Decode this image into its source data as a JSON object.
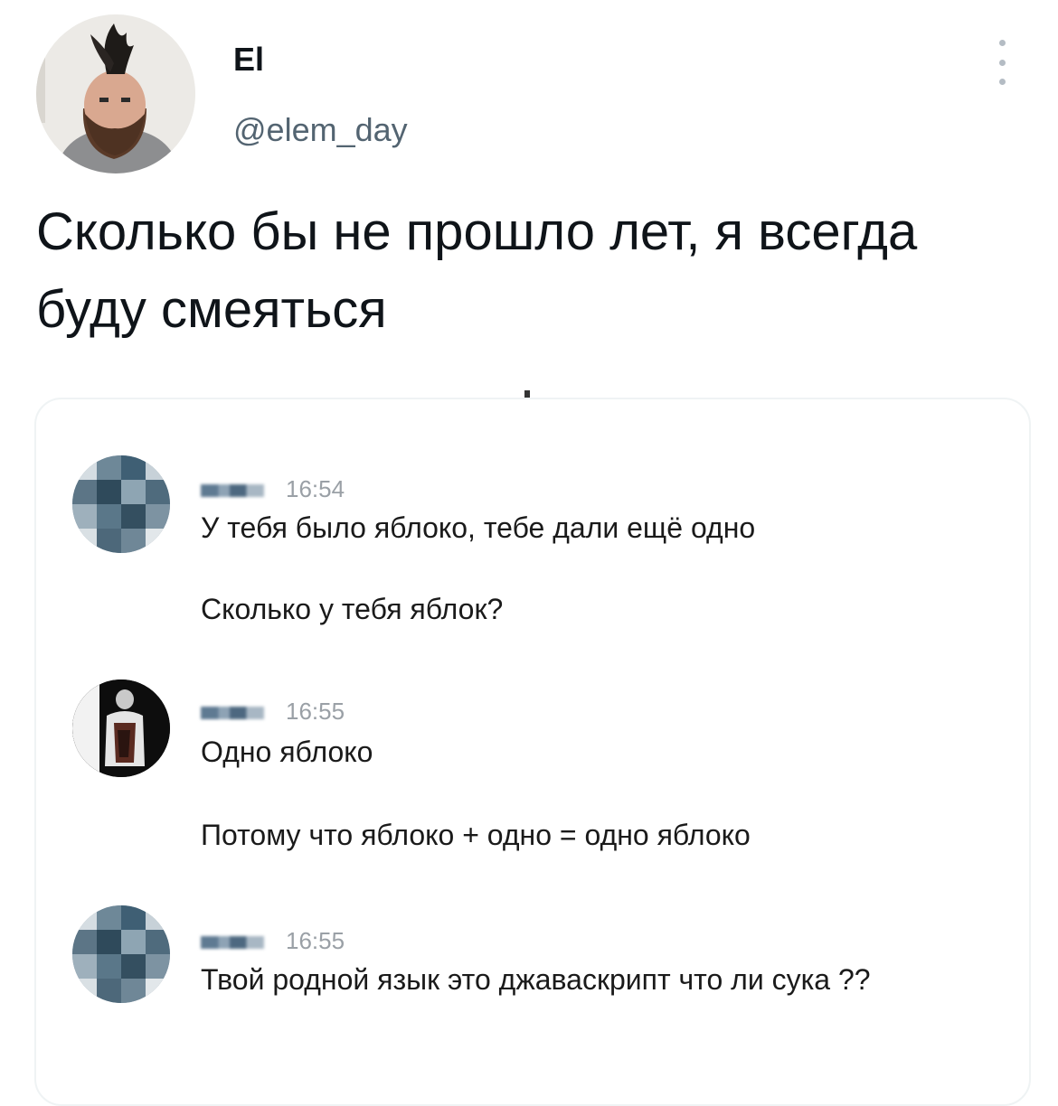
{
  "tweet": {
    "author": {
      "display_name": "El",
      "handle": "@elem_day"
    },
    "text": "Сколько бы не прошло лет, я всегда буду смеяться"
  },
  "screenshot": {
    "messages": [
      {
        "time": "16:54",
        "lines": [
          "У тебя было яблоко, тебе дали ещё одно",
          "Сколько у тебя яблок?"
        ]
      },
      {
        "time": "16:55",
        "lines": [
          "Одно яблоко",
          "Потому что яблоко + одно = одно яблоко"
        ]
      },
      {
        "time": "16:55",
        "lines": [
          "Твой родной язык это джаваскрипт что ли сука ??"
        ]
      }
    ]
  },
  "colors": {
    "text_primary": "#0f1419",
    "text_secondary": "#536471",
    "card_border": "#eff3f4",
    "timestamp": "#9aa0a6"
  },
  "icons": {
    "more": "more-vertical-icon"
  }
}
